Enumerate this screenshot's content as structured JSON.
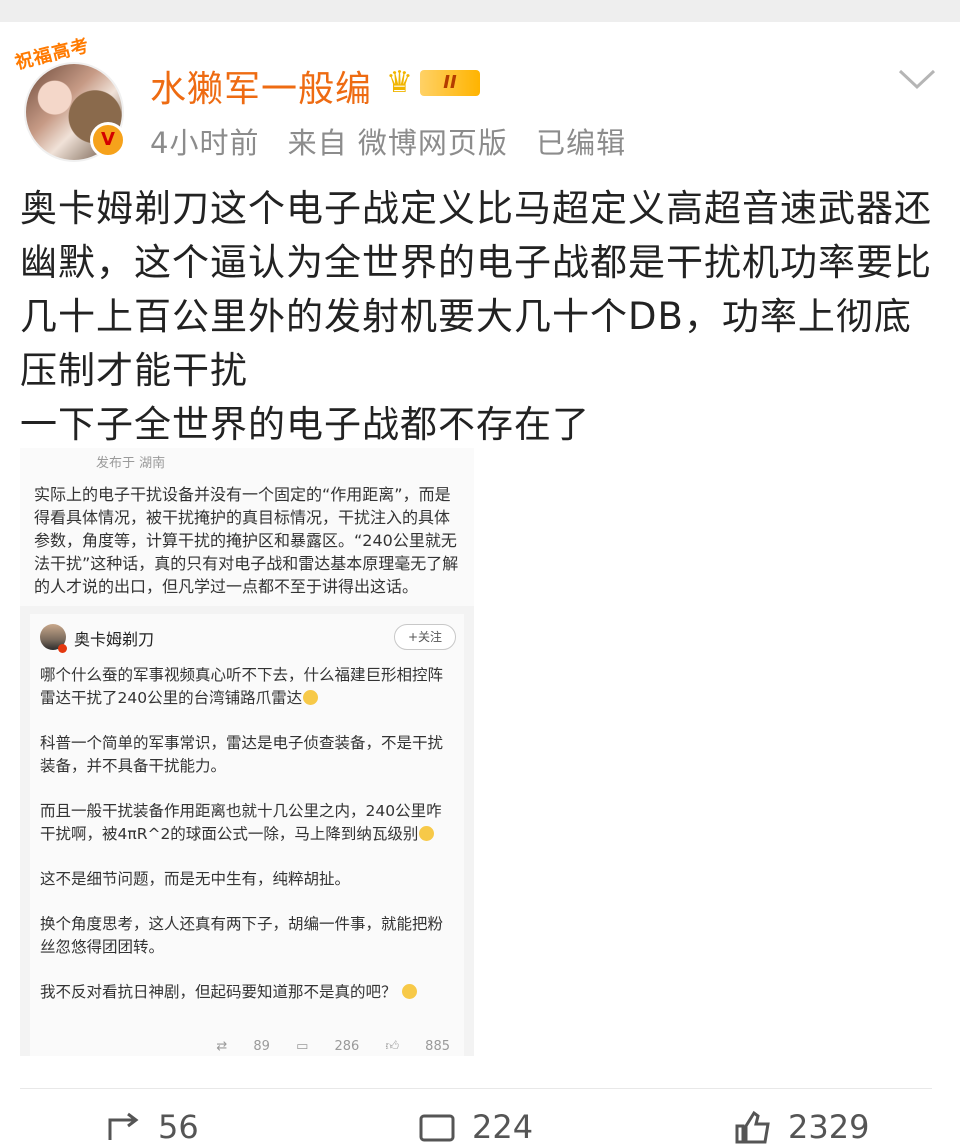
{
  "header": {
    "avatar_ribbon": "祝福高考",
    "username": "水獭军一般编",
    "rank_badge": "II",
    "time": "4小时前",
    "source": "来自 微博网页版",
    "edited": "已编辑",
    "accent_color": "#ee6b12"
  },
  "post": {
    "text": "奥卡姆剃刀这个电子战定义比马超定义高超音速武器还幽默，这个逼认为全世界的电子战都是干扰机功率要比几十上百公里外的发射机要大几十个DB，功率上彻底压制才能干扰\n一下子全世界的电子战都不存在了"
  },
  "embedded": {
    "location": "发布于 湖南",
    "reply_text": "实际上的电子干扰设备并没有一个固定的“作用距离”，而是得看具体情况，被干扰掩护的真目标情况，干扰注入的具体参数，角度等，计算干扰的掩护区和暴露区。“240公里就无法干扰”这种话，真的只有对电子战和雷达基本原理毫无了解的人才说的出口，但凡学过一点都不至于讲得出这话。",
    "quoted_user": "奥卡姆剃刀",
    "follow_label": "+关注",
    "paragraphs": [
      "哪个什么蚕的军事视频真心听不下去，什么福建巨形相控阵雷达干扰了240公里的台湾铺路爪雷达",
      "科普一个简单的军事常识，雷达是电子侦查装备，不是干扰装备，并不具备干扰能力。",
      "而且一般干扰装备作用距离也就十几公里之内，240公里咋干扰啊，被4πR^2的球面公式一除，马上降到纳瓦级别",
      "这不是细节问题，而是无中生有，纯粹胡扯。",
      "换个角度思考，这人还真有两下子，胡编一件事，就能把粉丝忽悠得团团转。",
      "我不反对看抗日神剧，但起码要知道那不是真的吧？"
    ],
    "stats": {
      "repost": "89",
      "comment": "286",
      "like": "885"
    }
  },
  "actions": {
    "repost_count": "56",
    "comment_count": "224",
    "like_count": "2329"
  }
}
